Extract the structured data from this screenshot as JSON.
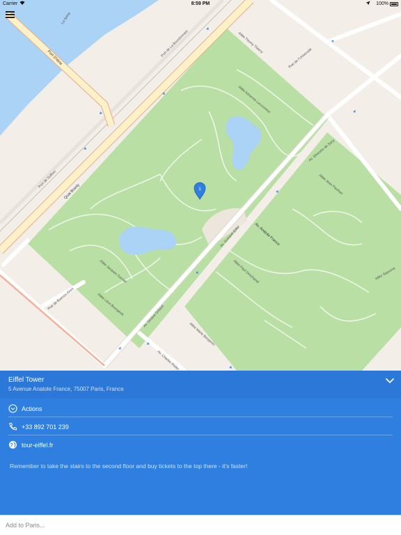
{
  "status_bar": {
    "carrier": "Carrier",
    "time": "8:59 PM",
    "battery": "100%"
  },
  "map": {
    "streets": {
      "la_seine": "La Seine",
      "port_iena": "Port D'Iéna",
      "port_bourdonnais": "Port de La Bourdonnais",
      "port_suffren": "Port de Suffren",
      "quai_branly": "Quai Branly",
      "allee_thomy_thierry": "Allée Thomy Thierry",
      "allee_adrienne_lecouvreur": "Allée Adrienne Lecouvreur",
      "rue_universite": "Rue de l'Université",
      "av_silvestre_sacy": "Av. Silvestre de Sacy",
      "allee_jean_paulhan": "Allée Jean Paulhan",
      "av_gustave_eiffel": "Av. Gustave Eiffel",
      "av_anatole_france": "Av. Anatole France",
      "allee_paul_deschanel": "Allée Paul Deschanel",
      "allee_jacques_garnier": "Allée Jacques Garnier",
      "allee_leon_bourgeois": "Allée Léon Bourgeois",
      "rue_buenos_aires": "Rue de Buenos Aires",
      "av_octave_gerard": "Av. Octave Gréard",
      "av_charles_risler": "Av. Charles Risler",
      "allee_marie_benjamin": "Allée Marie Benjamin",
      "allee_sejourne": "Allée Sejourne"
    },
    "pin_label": "1"
  },
  "colors": {
    "panel": "#2f7fe0",
    "water": "#aad3f5",
    "park": "#b7dea2",
    "road_major": "#fdf1c8",
    "pin": "#2f7fe0"
  },
  "place": {
    "name": "Eiffel Tower",
    "address": "5 Avenue Anatole France, 75007 Paris, France",
    "actions_label": "Actions",
    "phone": "+33 892 701 239",
    "website": "tour-eiffel.fr",
    "note": "Remember to take the stairs to the second floor and buy tickets to the top there - it's faster!"
  },
  "add_input": {
    "placeholder": "Add to Paris..."
  }
}
